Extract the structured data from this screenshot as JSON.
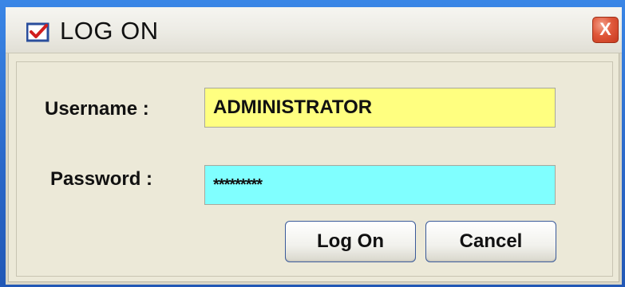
{
  "window": {
    "title": "LOG ON",
    "close_symbol": "X",
    "title_icon": "checkbox-check-icon",
    "close_icon": "close-icon"
  },
  "form": {
    "username_label": "Username :",
    "username_value": "ADMINISTRATOR",
    "password_label": "Password :",
    "password_value": "*********"
  },
  "buttons": {
    "logon_label": "Log On",
    "cancel_label": "Cancel"
  },
  "colors": {
    "username_bg": "#ffff80",
    "password_bg": "#80ffff",
    "close_button": "#d9472a"
  }
}
